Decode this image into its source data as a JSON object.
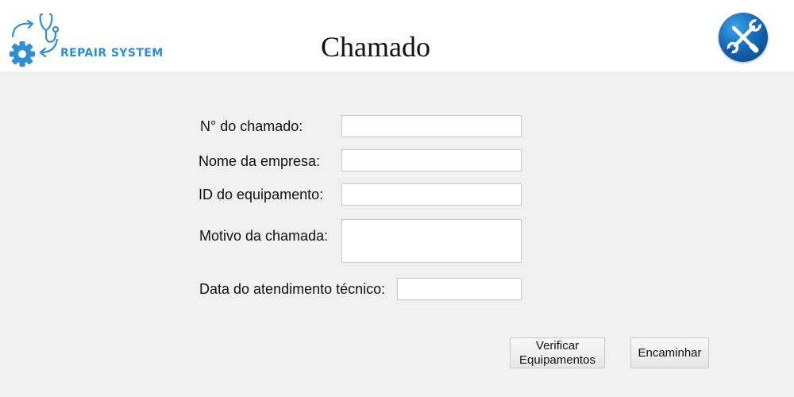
{
  "header": {
    "logo_text": "REPAIR SYSTEM",
    "title": "Chamado",
    "tools_icon": "tools-icon"
  },
  "form": {
    "numero_label": "N° do chamado:",
    "numero_value": "",
    "empresa_label": "Nome da empresa:",
    "empresa_value": "",
    "equipamento_label": "ID do equipamento:",
    "equipamento_value": "",
    "motivo_label": "Motivo da chamada:",
    "motivo_value": "",
    "data_label": "Data do atendimento técnico:",
    "data_value": ""
  },
  "actions": {
    "verificar_label_line1": "Verificar",
    "verificar_label_line2": "Equipamentos",
    "encaminhar_label": "Encaminhar"
  },
  "colors": {
    "accent": "#2e8fd6",
    "background": "#f0f0f0",
    "header_background": "#ffffff",
    "badge": "#1669b8"
  },
  "icons": [
    "stethoscope-icon",
    "gear-icon",
    "tools-icon"
  ]
}
